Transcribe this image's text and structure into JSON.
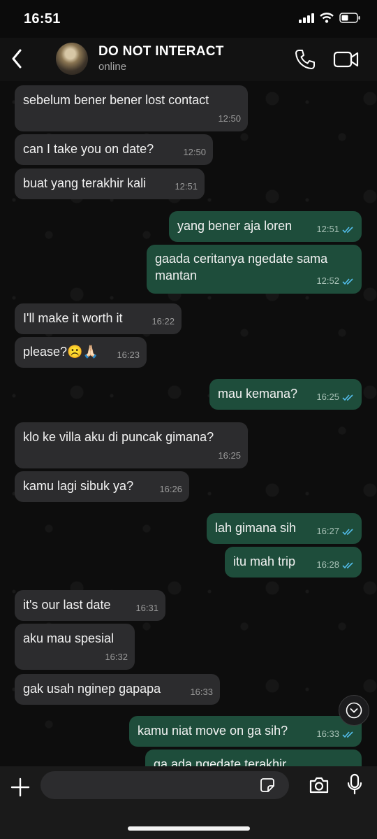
{
  "status_bar": {
    "time": "16:51"
  },
  "header": {
    "contact_name": "DO NOT INTERACT",
    "contact_status": "online"
  },
  "messages": [
    {
      "text": "sebelum bener bener lost contact",
      "time": "12:50",
      "direction": "in"
    },
    {
      "text": "can I take you on date?",
      "time": "12:50",
      "direction": "in"
    },
    {
      "text": "buat yang terakhir kali",
      "time": "12:51",
      "direction": "in"
    },
    {
      "text": "yang bener aja loren",
      "time": "12:51",
      "direction": "out"
    },
    {
      "text": "gaada ceritanya ngedate sama mantan",
      "time": "12:52",
      "direction": "out"
    },
    {
      "text": "I'll make it worth it",
      "time": "16:22",
      "direction": "in"
    },
    {
      "text": "please?☹️🙏🏻",
      "time": "16:23",
      "direction": "in"
    },
    {
      "text": "mau kemana?",
      "time": "16:25",
      "direction": "out"
    },
    {
      "text": "klo ke villa aku di puncak gimana?",
      "time": "16:25",
      "direction": "in"
    },
    {
      "text": "kamu lagi sibuk ya?",
      "time": "16:26",
      "direction": "in"
    },
    {
      "text": "lah gimana sih",
      "time": "16:27",
      "direction": "out"
    },
    {
      "text": "itu mah trip",
      "time": "16:28",
      "direction": "out"
    },
    {
      "text": "it's our last date",
      "time": "16:31",
      "direction": "in"
    },
    {
      "text": "aku mau spesial",
      "time": "16:32",
      "direction": "in"
    },
    {
      "text": "gak usah nginep gapapa",
      "time": "16:33",
      "direction": "in"
    },
    {
      "text": "kamu niat move on ga sih?",
      "time": "16:33",
      "direction": "out"
    },
    {
      "text": "ga ada ngedate terakhir",
      "time": "",
      "direction": "out"
    }
  ],
  "input": {
    "placeholder": ""
  },
  "icons": {
    "back": "chevron-left-icon",
    "call": "phone-icon",
    "video": "video-camera-icon",
    "scroll": "chevron-down-icon",
    "plus": "plus-icon",
    "sticker": "sticker-icon",
    "camera": "camera-icon",
    "mic": "microphone-icon"
  },
  "colors": {
    "incoming_bubble": "#2c2c2e",
    "outgoing_bubble": "#1e4d3b",
    "read_tick": "#53bdeb"
  }
}
